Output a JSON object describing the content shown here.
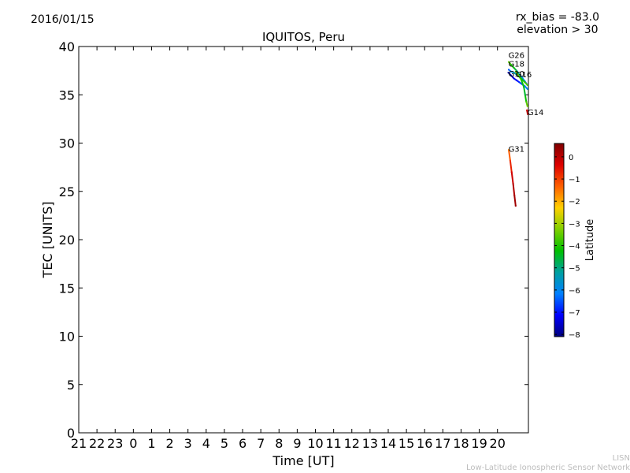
{
  "header": {
    "date": "2016/01/15",
    "rx_bias": "rx_bias = -83.0",
    "elevation": "elevation > 30"
  },
  "footer": {
    "line1": "LISN",
    "line2": "Low-Latitude Ionospheric Sensor Network"
  },
  "chart_data": {
    "type": "scatter",
    "title": "IQUITOS, Peru",
    "xlabel": "Time [UT]",
    "ylabel": "TEC [UNITS]",
    "xlim": [
      21,
      45.7
    ],
    "ylim": [
      0,
      40
    ],
    "x_tick_labels": [
      "21",
      "22",
      "23",
      "0",
      "1",
      "2",
      "3",
      "4",
      "5",
      "6",
      "7",
      "8",
      "9",
      "10",
      "11",
      "12",
      "13",
      "14",
      "15",
      "16",
      "17",
      "18",
      "19",
      "20"
    ],
    "y_ticks": [
      0,
      5,
      10,
      15,
      20,
      25,
      30,
      35,
      40
    ],
    "grid": false,
    "colorbar": {
      "label": "Latitude",
      "ticks": [
        0,
        -1,
        -2,
        -3,
        -4,
        -5,
        -6,
        -7,
        -8
      ],
      "range": [
        -8.1,
        0.6
      ],
      "colors": [
        "#00007f",
        "#0000ff",
        "#0080ff",
        "#00a0a0",
        "#00c000",
        "#80d000",
        "#ffd000",
        "#ff6000",
        "#dd0000",
        "#7f0000"
      ]
    },
    "series": [
      {
        "name": "G26",
        "points": [
          {
            "t": 44.62,
            "tec": 38.4,
            "lat": -3.5
          },
          {
            "t": 44.75,
            "tec": 38.1,
            "lat": -4.0
          },
          {
            "t": 44.9,
            "tec": 37.8,
            "lat": -4.3
          },
          {
            "t": 45.05,
            "tec": 37.5,
            "lat": -4.8
          },
          {
            "t": 45.2,
            "tec": 37.1,
            "lat": -5.3
          },
          {
            "t": 45.35,
            "tec": 36.8,
            "lat": -5.8
          },
          {
            "t": 45.5,
            "tec": 36.4,
            "lat": -6.3
          },
          {
            "t": 45.65,
            "tec": 36.0,
            "lat": -6.7
          }
        ]
      },
      {
        "name": "G18",
        "points": [
          {
            "t": 44.62,
            "tec": 37.6,
            "lat": -6.5
          },
          {
            "t": 44.75,
            "tec": 37.4,
            "lat": -6.0
          },
          {
            "t": 44.9,
            "tec": 37.3,
            "lat": -5.5
          },
          {
            "t": 45.05,
            "tec": 37.1,
            "lat": -5.0
          },
          {
            "t": 45.2,
            "tec": 36.9,
            "lat": -4.6
          },
          {
            "t": 45.35,
            "tec": 36.6,
            "lat": -4.2
          },
          {
            "t": 45.5,
            "tec": 36.3,
            "lat": -3.8
          },
          {
            "t": 45.65,
            "tec": 36.0,
            "lat": -3.5
          }
        ]
      },
      {
        "name": "G10",
        "points": [
          {
            "t": 44.6,
            "tec": 37.3,
            "lat": -7.9
          },
          {
            "t": 44.75,
            "tec": 37.0,
            "lat": -7.7
          },
          {
            "t": 44.9,
            "tec": 36.7,
            "lat": -7.4
          },
          {
            "t": 45.05,
            "tec": 36.5,
            "lat": -7.1
          },
          {
            "t": 45.2,
            "tec": 36.3,
            "lat": -6.8
          },
          {
            "t": 45.35,
            "tec": 36.1,
            "lat": -6.5
          },
          {
            "t": 45.5,
            "tec": 35.9,
            "lat": -6.2
          },
          {
            "t": 45.65,
            "tec": 35.6,
            "lat": -5.9
          }
        ]
      },
      {
        "name": "G16",
        "points": [
          {
            "t": 45.0,
            "tec": 37.4,
            "lat": -3.2
          },
          {
            "t": 45.15,
            "tec": 37.0,
            "lat": -3.6
          },
          {
            "t": 45.3,
            "tec": 36.6,
            "lat": -4.0
          },
          {
            "t": 45.45,
            "tec": 35.8,
            "lat": -4.4
          },
          {
            "t": 45.52,
            "tec": 35.0,
            "lat": -4.6
          },
          {
            "t": 45.58,
            "tec": 34.3,
            "lat": -3.8
          },
          {
            "t": 45.65,
            "tec": 33.8,
            "lat": -3.2
          }
        ]
      },
      {
        "name": "G14",
        "points": [
          {
            "t": 45.62,
            "tec": 33.4,
            "lat": -0.3
          },
          {
            "t": 45.66,
            "tec": 33.0,
            "lat": 0.2
          }
        ]
      },
      {
        "name": "G31",
        "points": [
          {
            "t": 44.62,
            "tec": 29.3,
            "lat": -1.6
          },
          {
            "t": 44.7,
            "tec": 28.2,
            "lat": -1.0
          },
          {
            "t": 44.78,
            "tec": 27.0,
            "lat": -0.4
          },
          {
            "t": 44.86,
            "tec": 25.8,
            "lat": 0.0
          },
          {
            "t": 44.93,
            "tec": 24.6,
            "lat": 0.2
          },
          {
            "t": 45.0,
            "tec": 23.5,
            "lat": 0.3
          }
        ]
      }
    ],
    "series_labels": [
      {
        "name": "G26",
        "t": 44.6,
        "tec": 38.8
      },
      {
        "name": "G18",
        "t": 44.6,
        "tec": 37.9
      },
      {
        "name": "G10",
        "t": 44.6,
        "tec": 36.9
      },
      {
        "name": "G16",
        "t": 45.0,
        "tec": 36.8
      },
      {
        "name": "G14",
        "t": 45.65,
        "tec": 32.9
      },
      {
        "name": "G31",
        "t": 44.6,
        "tec": 29.1
      }
    ]
  }
}
